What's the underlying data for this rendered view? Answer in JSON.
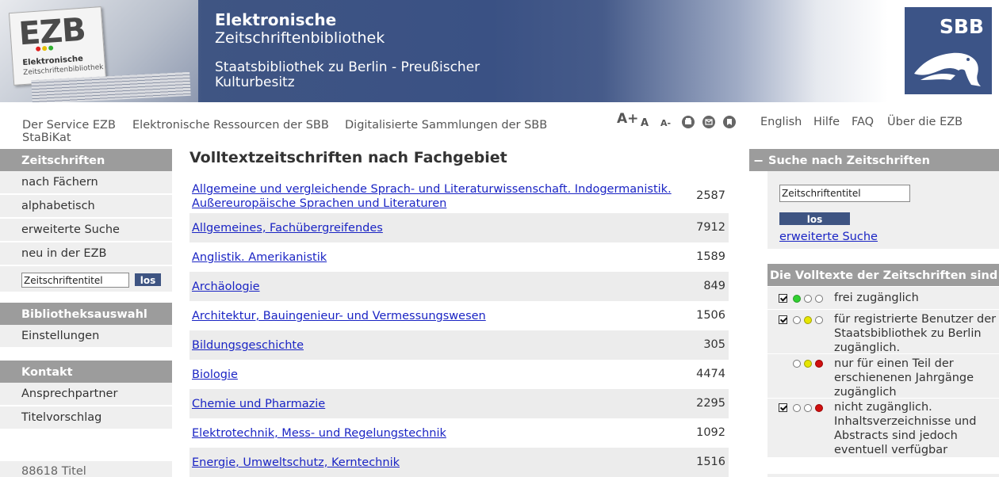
{
  "header": {
    "logo_letters": "EZB",
    "logo_line1": "Elektronische",
    "logo_line2": "Zeitschriftenbibliothek",
    "title_line1": "Elektronische",
    "title_line2": "Zeitschriftenbibliothek",
    "institution_line1": "Staatsbibliothek zu Berlin - Preußischer",
    "institution_line2": "Kulturbesitz",
    "partner_logo": "SBB"
  },
  "topnav": {
    "links": [
      "Der Service EZB",
      "Elektronische Ressourcen der SBB",
      "Digitalisierte Sammlungen der SBB"
    ],
    "second_line": "StaBiKat",
    "font_tools": [
      "A+",
      "A",
      "A-"
    ],
    "tool_icons": [
      "print-icon",
      "mail-icon",
      "bookmark-icon"
    ],
    "right_links": [
      "English",
      "Hilfe",
      "FAQ",
      "Über die EZB"
    ]
  },
  "sidebar": {
    "zeitschriften": {
      "heading": "Zeitschriften",
      "items": [
        "nach Fächern",
        "alphabetisch",
        "erweiterte Suche",
        "neu in der EZB"
      ],
      "search_value": "Zeitschriftentitel",
      "search_button": "los"
    },
    "bibliothek": {
      "heading": "Bibliotheksauswahl",
      "items": [
        "Einstellungen"
      ]
    },
    "kontakt": {
      "heading": "Kontakt",
      "items": [
        "Ansprechpartner",
        "Titelvorschlag"
      ]
    },
    "count_text": "88618 Titel"
  },
  "main": {
    "title": "Volltextzeitschriften nach Fachgebiet",
    "subjects": [
      {
        "name_line1": "Allgemeine und vergleichende Sprach- und Literaturwissenschaft. Indogermanistik.",
        "name_line2": "Außereuropäische Sprachen und Literaturen",
        "count": "2587"
      },
      {
        "name_line1": "Allgemeines, Fachübergreifendes",
        "count": "7912"
      },
      {
        "name_line1": "Anglistik. Amerikanistik",
        "count": "1589"
      },
      {
        "name_line1": "Archäologie",
        "count": "849"
      },
      {
        "name_line1": "Architektur, Bauingenieur- und Vermessungswesen",
        "count": "1506"
      },
      {
        "name_line1": "Bildungsgeschichte",
        "count": "305"
      },
      {
        "name_line1": "Biologie",
        "count": "4474"
      },
      {
        "name_line1": "Chemie und Pharmazie",
        "count": "2295"
      },
      {
        "name_line1": "Elektrotechnik, Mess- und Regelungstechnik",
        "count": "1092"
      },
      {
        "name_line1": "Energie, Umweltschutz, Kerntechnik",
        "count": "1516"
      }
    ]
  },
  "right": {
    "search": {
      "heading": "Suche nach Zeitschriften",
      "collapse_symbol": "−",
      "input_value": "Zeitschriftentitel",
      "button": "los",
      "advanced_link": "erweiterte Suche"
    },
    "legend": {
      "heading": "Die Volltexte der Zeitschriften sind",
      "items": [
        {
          "checked": true,
          "dots": [
            "green",
            "off",
            "off"
          ],
          "text": "frei zugänglich"
        },
        {
          "checked": true,
          "dots": [
            "off",
            "yellow",
            "off"
          ],
          "text_line1": "für registrierte Benutzer der",
          "text_line2": "Staatsbibliothek zu Berlin",
          "text_line3": "zugänglich."
        },
        {
          "checked": false,
          "dots": [
            "off",
            "yellow",
            "red"
          ],
          "text_line1": "nur für einen Teil der",
          "text_line2": "erschienenen Jahrgänge",
          "text_line3": "zugänglich"
        },
        {
          "checked": true,
          "dots": [
            "off",
            "off",
            "red"
          ],
          "text_line1": "nicht zugänglich.",
          "text_line2": "Inhaltsverzeichnisse und",
          "text_line3": "Abstracts sind jedoch",
          "text_line4": "eventuell verfügbar"
        }
      ]
    }
  },
  "colors": {
    "header_blue": "#3a5184",
    "link": "#1a24c4",
    "sidebar_head": "#9c9c9c",
    "sidebar_item": "#efefef",
    "button": "#3e5482"
  }
}
